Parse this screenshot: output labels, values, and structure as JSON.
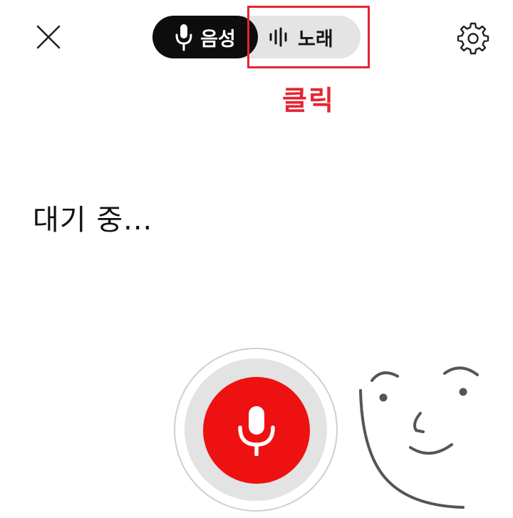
{
  "header": {
    "close_icon": "close-icon",
    "settings_icon": "gear-icon",
    "mode_toggle": {
      "selected": "voice",
      "voice": {
        "label": "음성",
        "icon": "microphone-icon"
      },
      "song": {
        "label": "노래",
        "icon": "waveform-icon"
      }
    }
  },
  "annotation": {
    "label": "클릭",
    "color": "#e52532"
  },
  "main": {
    "status": "대기 중..."
  },
  "mic": {
    "icon": "microphone-icon",
    "color": "#ee1111"
  },
  "decoration": {
    "icon": "face-doodle"
  }
}
